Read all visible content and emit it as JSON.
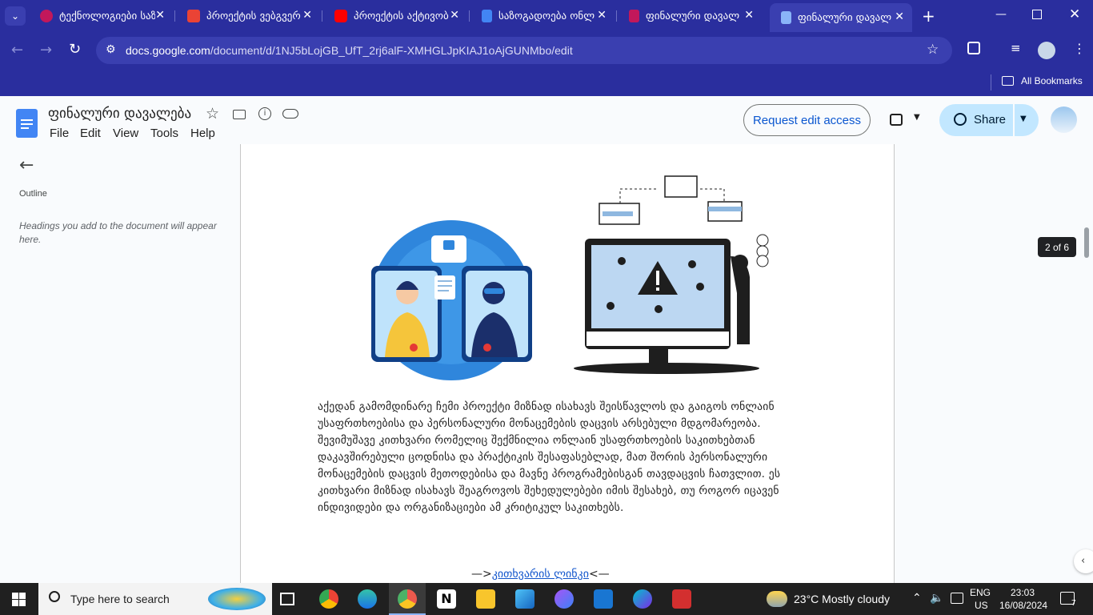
{
  "browser": {
    "tabs": [
      {
        "title": "ტექნოლოგიები საზ",
        "icon": "github-icon",
        "color": "#c2185b"
      },
      {
        "title": "პროექტის ვებგვერ",
        "icon": "gmail-icon",
        "color": "#ea4335"
      },
      {
        "title": "პროექტის აქტივობ",
        "icon": "youtube-icon",
        "color": "#ff0000"
      },
      {
        "title": "საზოგადოება ონლა",
        "icon": "docs-icon",
        "color": "#4285f4"
      },
      {
        "title": "ფინალური დავალ",
        "icon": "forms-icon",
        "color": "#c2185b"
      },
      {
        "title": "ფინალური დავალ",
        "icon": "docs-icon",
        "color": "#4285f4",
        "active": true
      }
    ],
    "url_domain": "docs.google.com",
    "url_path": "/document/d/1NJ5bLojGB_UfT_2rj6alF-XMHGLJpKIAJ1oAjGUNMbo/edit",
    "bookmarks_label": "All Bookmarks"
  },
  "docs": {
    "title": "ფინალური დავალება",
    "menu": [
      "File",
      "Edit",
      "View",
      "Tools",
      "Help"
    ],
    "request_edit_label": "Request edit access",
    "share_label": "Share"
  },
  "outline": {
    "title": "Outline",
    "hint": "Headings you add to the document will appear here."
  },
  "document": {
    "paragraph": "აქედან გამომდინარე ჩემი პროექტი მიზნად ისახავს შეისწავლოს და გაიგოს ონლაინ უსაფრთხოებისა და პერსონალური მონაცემების დაცვის არსებული მდგომარეობა. შევიმუშავე კითხვარი რომელიც შექმნილია ონლაინ უსაფრთხოების საკითხებთან დაკავშირებული ცოდნისა და პრაქტიკის შესაფასებლად, მათ შორის პერსონალური მონაცემების დაცვის მეთოდებისა და მავნე პროგრამებისგან თავდაცვის ჩათვლით. ეს კითხვარი მიზნად ისახავს შეაგროვოს შეხედულებები იმის შესახებ, თუ როგორ იცავენ ინდივიდები და ორგანიზაციები ამ კრიტიკულ საკითხებს.",
    "link_prefix": "—>",
    "link_text": "კითხვარის ლინკი",
    "link_suffix": "<—",
    "page_indicator": "2 of 6"
  },
  "taskbar": {
    "search_placeholder": "Type here to search",
    "weather": "23°C  Mostly cloudy",
    "lang_top": "ENG",
    "lang_bottom": "US",
    "time": "23:03",
    "date": "16/08/2024",
    "notification_count": "7"
  }
}
